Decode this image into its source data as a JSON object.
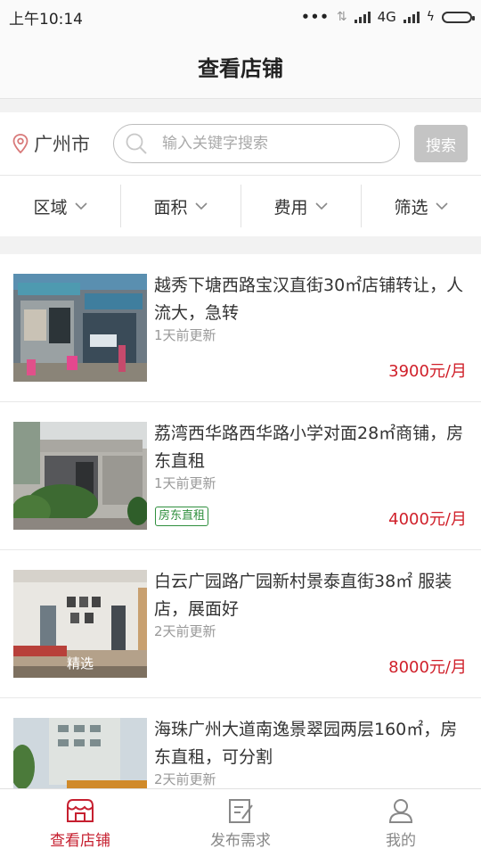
{
  "status_bar": {
    "time": "上午10:14",
    "network": "4G"
  },
  "header": {
    "title": "查看店铺"
  },
  "search": {
    "city": "广州市",
    "placeholder": "输入关键字搜索",
    "button_label": "搜索"
  },
  "filters": [
    {
      "label": "区域"
    },
    {
      "label": "面积"
    },
    {
      "label": "费用"
    },
    {
      "label": "筛选"
    }
  ],
  "listings": [
    {
      "title": "越秀下塘西路宝汉直街30㎡店铺转让，人流大，急转",
      "updated": "1天前更新",
      "price": "3900元/月",
      "badge": "",
      "image_tag": ""
    },
    {
      "title": "荔湾西华路西华路小学对面28㎡商铺，房东直租",
      "updated": "1天前更新",
      "price": "4000元/月",
      "badge": "房东直租",
      "image_tag": ""
    },
    {
      "title": "白云广园路广园新村景泰直街38㎡ 服装店，展面好",
      "updated": "2天前更新",
      "price": "8000元/月",
      "badge": "",
      "image_tag": "精选"
    },
    {
      "title": "海珠广州大道南逸景翠园两层160㎡，房东直租，可分割",
      "updated": "2天前更新",
      "price": "",
      "badge": "",
      "image_tag": ""
    }
  ],
  "tabs": [
    {
      "label": "查看店铺",
      "icon": "shop-icon",
      "active": true
    },
    {
      "label": "发布需求",
      "icon": "edit-icon",
      "active": false
    },
    {
      "label": "我的",
      "icon": "user-icon",
      "active": false
    }
  ],
  "colors": {
    "accent": "#c62030",
    "price": "#d0202a",
    "badge": "#2f8f3e",
    "search_button": "#c4c4c4"
  }
}
